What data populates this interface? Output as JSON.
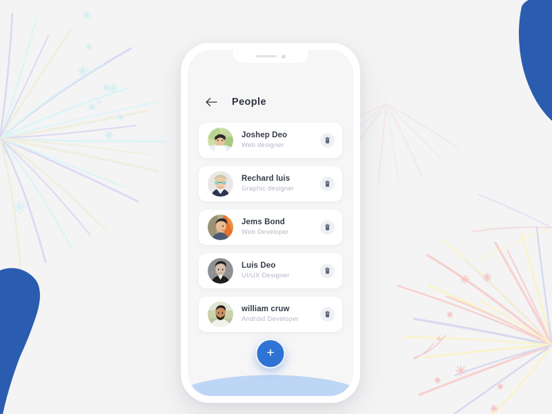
{
  "background": {
    "canvas_color": "#f4f4f5",
    "blob_color": "#2a5cb0",
    "firework_left_colors": [
      "#ddf6f7",
      "#d8d5f2",
      "#f0eedb"
    ],
    "firework_right_colors": [
      "#f7cfcc",
      "#fbf2c4",
      "#d6d8ee"
    ],
    "blob_top_right_name": "blue-blob-top-right",
    "blob_bottom_left_name": "blue-blob-bottom-left",
    "firework_left_name": "firework-burst-left",
    "firework_right_name": "firework-burst-right"
  },
  "phone": {
    "frame_color": "#ffffff",
    "screen_color": "#f6f6f7",
    "notch": {
      "speaker_label": "speaker-grill",
      "camera_label": "front-camera"
    }
  },
  "header": {
    "back_icon": "arrow-left-icon",
    "title": "People"
  },
  "list": {
    "delete_icon": "trash-icon",
    "people": [
      {
        "name": "Joshep Deo",
        "role": "Web designer",
        "avatar": "avatar-joshep-deo",
        "avatar_bg": "#c9dca4",
        "avatar_skin": "#e8c49a",
        "avatar_hair": "#2b2b2f",
        "avatar_shirt": "#e8f0f6"
      },
      {
        "name": "Rechard luis",
        "role": "Graphic designer",
        "avatar": "avatar-rechard-luis",
        "avatar_bg": "#e9e8e6",
        "avatar_skin": "#f0cba6",
        "avatar_hair": "#cfc3ad",
        "avatar_shirt": "#2e3550"
      },
      {
        "name": "Jems Bond",
        "role": "Web Developer",
        "avatar": "avatar-jems-bond",
        "avatar_bg": "#e3742f",
        "avatar_skin": "#e9bb92",
        "avatar_hair": "#24242a",
        "avatar_shirt": "#4a5a74"
      },
      {
        "name": "Luis Deo",
        "role": "UI/UX Designer",
        "avatar": "avatar-luis-deo",
        "avatar_bg": "#8f9094",
        "avatar_skin": "#d9c0ab",
        "avatar_hair": "#1d1d20",
        "avatar_shirt": "#1d1d20"
      },
      {
        "name": "william cruw",
        "role": "Android Developer",
        "avatar": "avatar-william-cruw",
        "avatar_bg": "#cdd3b8",
        "avatar_skin": "#c98f63",
        "avatar_hair": "#241c18",
        "avatar_shirt": "#f2f0ea"
      }
    ]
  },
  "bottom": {
    "fab_label": "+",
    "fab_color": "#2f73d4",
    "wave_color": "#bed6f5",
    "home_indicator": "home-indicator-ring"
  }
}
